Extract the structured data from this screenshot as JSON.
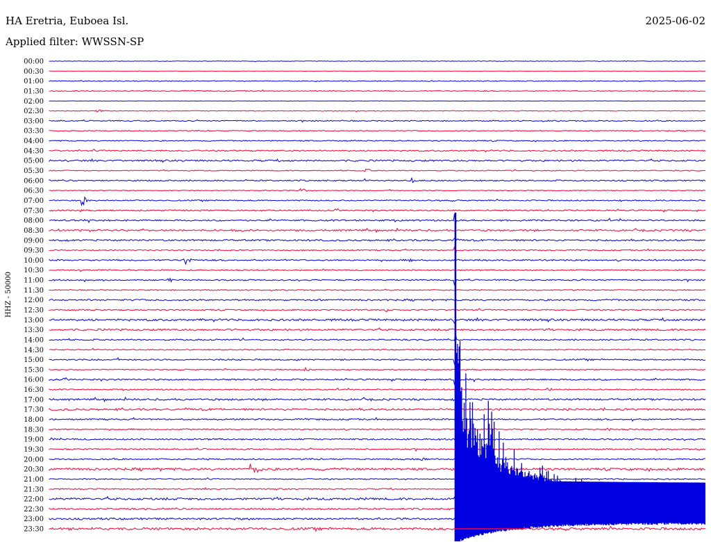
{
  "header": {
    "station": "HA Eretria, Euboea Isl.",
    "date": "2025-06-02",
    "filter": "Applied filter: WWSSN-SP"
  },
  "chart_data": {
    "type": "line",
    "ylabel": "HHZ - 50000",
    "colors": {
      "odd": "#0000e0",
      "even": "#ff0033"
    },
    "rows": [
      "00:00",
      "00:30",
      "01:00",
      "01:30",
      "02:00",
      "02:30",
      "03:00",
      "03:30",
      "04:00",
      "04:30",
      "05:00",
      "05:30",
      "06:00",
      "06:30",
      "07:00",
      "07:30",
      "08:00",
      "08:30",
      "09:00",
      "09:30",
      "10:00",
      "10:30",
      "11:00",
      "11:30",
      "12:00",
      "12:30",
      "13:00",
      "13:30",
      "14:00",
      "14:30",
      "15:00",
      "15:30",
      "16:00",
      "16:30",
      "17:00",
      "17:30",
      "18:00",
      "18:30",
      "19:00",
      "19:30",
      "20:00",
      "20:30",
      "21:00",
      "21:30",
      "22:00",
      "22:30",
      "23:00",
      "23:30"
    ],
    "x_minutes": [
      0,
      30
    ],
    "row_noise": [
      0.4,
      0.3,
      0.7,
      0.8,
      0.3,
      0.6,
      0.9,
      0.8,
      0.9,
      1.2,
      1.4,
      0.8,
      1.1,
      0.7,
      1.0,
      1.2,
      1.3,
      1.4,
      1.4,
      0.9,
      1.3,
      1.0,
      1.1,
      0.9,
      1.3,
      1.1,
      1.7,
      1.6,
      1.2,
      0.9,
      1.2,
      0.9,
      1.3,
      1.0,
      1.5,
      1.6,
      1.2,
      1.1,
      1.3,
      1.2,
      1.2,
      1.9,
      1.0,
      1.0,
      1.9,
      1.4,
      1.6,
      2.0
    ],
    "events": [
      {
        "row": 5,
        "minute": 2.2,
        "amp": 2.5,
        "dur": 0.8
      },
      {
        "row": 11,
        "minute": 14.5,
        "amp": 3,
        "dur": 0.8
      },
      {
        "row": 12,
        "minute": 16.6,
        "amp": 5,
        "dur": 0.4
      },
      {
        "row": 13,
        "minute": 11.5,
        "amp": 6,
        "dur": 0.5
      },
      {
        "row": 14,
        "minute": 1.5,
        "amp": 9,
        "dur": 0.6
      },
      {
        "row": 17,
        "minute": 8.6,
        "amp": 4,
        "dur": 1.0
      },
      {
        "row": 18,
        "minute": 18.5,
        "amp": 6,
        "dur": 0.5
      },
      {
        "row": 20,
        "minute": 6.2,
        "amp": 7,
        "dur": 0.8
      },
      {
        "row": 20,
        "minute": 16.5,
        "amp": 2.5,
        "dur": 0.9
      },
      {
        "row": 22,
        "minute": 5.5,
        "amp": 6,
        "dur": 0.3
      },
      {
        "row": 25,
        "minute": 15.4,
        "amp": 5,
        "dur": 0.4
      },
      {
        "row": 31,
        "minute": 11.7,
        "amp": 3,
        "dur": 0.9
      },
      {
        "row": 33,
        "minute": 22.8,
        "amp": 3,
        "dur": 0.9
      },
      {
        "row": 36,
        "minute": 26.7,
        "amp": 4,
        "dur": 0.3
      },
      {
        "row": 37,
        "minute": 25.5,
        "amp": 3,
        "dur": 0.7
      },
      {
        "row": 40,
        "minute": 17.0,
        "amp": 4,
        "dur": 0.9
      },
      {
        "row": 41,
        "minute": 9.2,
        "amp": 10,
        "dur": 1.3
      }
    ],
    "mainshock": {
      "row": 37,
      "minute": 18.55,
      "precursor_rows": [
        16,
        19,
        22,
        26,
        28,
        30,
        32
      ],
      "precursor_amp": 10,
      "peak_amp": 190
    }
  }
}
